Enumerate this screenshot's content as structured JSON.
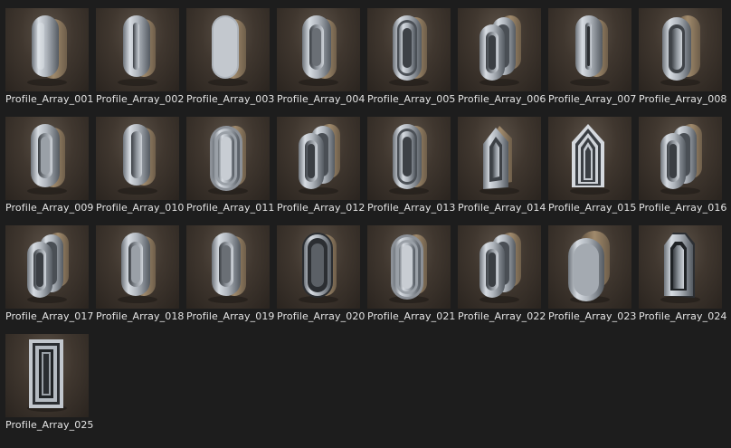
{
  "assets": [
    {
      "name": "Profile_Array_001",
      "shape": "capsule-solid"
    },
    {
      "name": "Profile_Array_002",
      "shape": "capsule-slot"
    },
    {
      "name": "Profile_Array_003",
      "shape": "capsule-flat"
    },
    {
      "name": "Profile_Array_004",
      "shape": "capsule-ring"
    },
    {
      "name": "Profile_Array_005",
      "shape": "capsule-ring-double"
    },
    {
      "name": "Profile_Array_006",
      "shape": "capsule-ring-array"
    },
    {
      "name": "Profile_Array_007",
      "shape": "capsule-slot-deep"
    },
    {
      "name": "Profile_Array_008",
      "shape": "capsule-ring-back"
    },
    {
      "name": "Profile_Array_009",
      "shape": "capsule-ring-bright"
    },
    {
      "name": "Profile_Array_010",
      "shape": "capsule-slot-thick"
    },
    {
      "name": "Profile_Array_011",
      "shape": "capsule-stepped"
    },
    {
      "name": "Profile_Array_012",
      "shape": "capsule-ring-array"
    },
    {
      "name": "Profile_Array_013",
      "shape": "capsule-ring-double"
    },
    {
      "name": "Profile_Array_014",
      "shape": "arch-pointed"
    },
    {
      "name": "Profile_Array_015",
      "shape": "arch-pointed-nested"
    },
    {
      "name": "Profile_Array_016",
      "shape": "capsule-ring-array"
    },
    {
      "name": "Profile_Array_017",
      "shape": "capsule-ring-array"
    },
    {
      "name": "Profile_Array_018",
      "shape": "capsule-ring-bright"
    },
    {
      "name": "Profile_Array_019",
      "shape": "capsule-ring"
    },
    {
      "name": "Profile_Array_020",
      "shape": "capsule-dark"
    },
    {
      "name": "Profile_Array_021",
      "shape": "capsule-stepped"
    },
    {
      "name": "Profile_Array_022",
      "shape": "capsule-ring-array"
    },
    {
      "name": "Profile_Array_023",
      "shape": "capsule-tray"
    },
    {
      "name": "Profile_Array_024",
      "shape": "arch-chamfer"
    },
    {
      "name": "Profile_Array_025",
      "shape": "rect-frame"
    }
  ],
  "colors": {
    "background": "#1d1d1d",
    "thumb_backdrop": "#40372f",
    "metal": "#b9bfc7",
    "label": "#e4e4e4"
  }
}
